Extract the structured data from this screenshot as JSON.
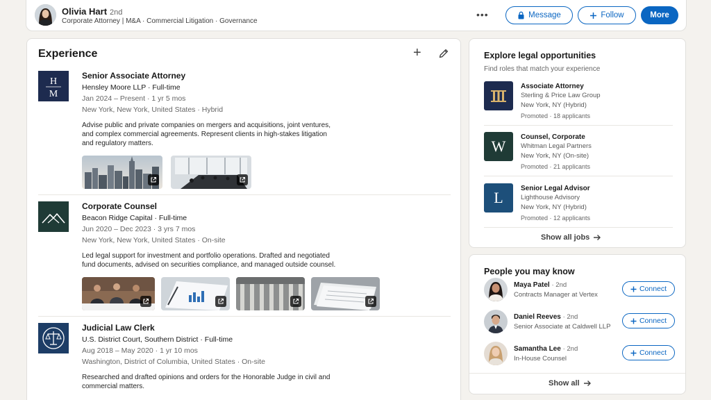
{
  "profile": {
    "name": "Olivia Hart",
    "degree": "2nd",
    "headline": "Corporate Attorney | M&A · Commercial Litigation · Governance",
    "more_dots": "•••",
    "message_label": "Message",
    "follow_label": "Follow",
    "more_label": "More"
  },
  "experience": {
    "title": "Experience",
    "add_symbol": "+",
    "positions": [
      {
        "logo_text": "HM",
        "title": "Senior Associate Attorney",
        "company": "Hensley Moore LLP · Full-time",
        "dates": "Jan 2024 – Present · 1 yr 5 mos",
        "location": "New York, New York, United States · Hybrid",
        "description": "Advise public and private companies on mergers and acquisitions, joint ventures, and complex commercial agreements. Represent clients in high-stakes litigation and regulatory matters."
      },
      {
        "title": "Corporate Counsel",
        "company": "Beacon Ridge Capital · Full-time",
        "dates": "Jun 2020 – Dec 2023 · 3 yrs 7 mos",
        "location": "New York, New York, United States · On-site",
        "description": "Led legal support for investment and portfolio operations. Drafted and negotiated fund documents, advised on securities compliance, and managed outside counsel."
      },
      {
        "title": "Judicial Law Clerk",
        "company": "U.S. District Court, Southern District · Full-time",
        "dates": "Aug 2018 – May 2020 · 1 yr 10 mos",
        "location": "Washington, District of Columbia, United States · On-site",
        "description": "Researched and drafted opinions and orders for the Honorable Judge in civil and commercial matters."
      }
    ]
  },
  "jobs": {
    "title": "Explore legal opportunities",
    "subtitle": "Find roles that match your experience",
    "items": [
      {
        "title": "Associate Attorney",
        "company": "Sterling & Price Law Group",
        "location": "New York, NY (Hybrid)",
        "promo": "Promoted · 18 applicants"
      },
      {
        "logo_text": "W",
        "title": "Counsel, Corporate",
        "company": "Whitman Legal Partners",
        "location": "New York, NY (On-site)",
        "promo": "Promoted · 21 applicants"
      },
      {
        "logo_text": "L",
        "title": "Senior Legal Advisor",
        "company": "Lighthouse Advisory",
        "location": "New York, NY (Hybrid)",
        "promo": "Promoted · 12 applicants"
      }
    ],
    "show_all": "Show all jobs"
  },
  "people": {
    "title": "People you may know",
    "connect_label": "Connect",
    "items": [
      {
        "name": "Maya Patel",
        "degree": "· 2nd",
        "headline": "Contracts Manager at Vertex"
      },
      {
        "name": "Daniel Reeves",
        "degree": "· 2nd",
        "headline": "Senior Associate at Caldwell LLP"
      },
      {
        "name": "Samantha Lee",
        "degree": "· 2nd",
        "headline": "In-House Counsel"
      }
    ],
    "show_all": "Show all"
  },
  "colors": {
    "accent": "#0a66c2",
    "navy_logo": "#1d2b4f",
    "green_logo": "#1f3b36"
  }
}
